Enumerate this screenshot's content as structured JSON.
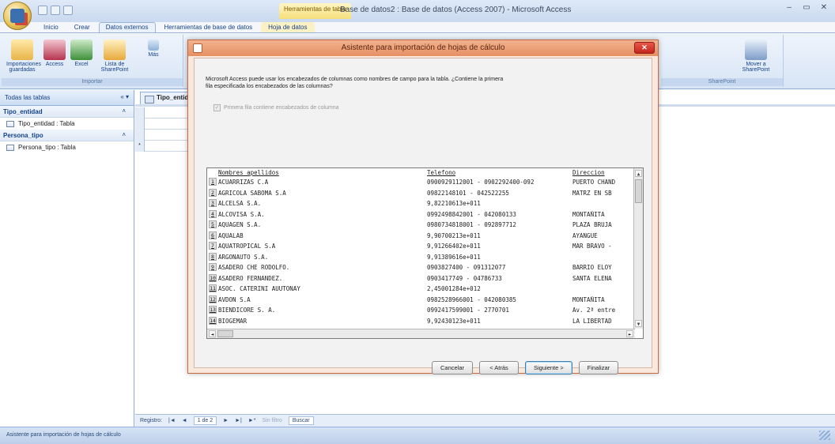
{
  "app": {
    "contextual_tab": "Herramientas de tabla",
    "window_title": "Base de datos2 : Base de datos (Access 2007) - Microsoft Access",
    "tabs": [
      "Inicio",
      "Crear",
      "Datos externos",
      "Herramientas de base de datos",
      "Hoja de datos"
    ],
    "window_buttons": [
      "–",
      "▭",
      "✕"
    ]
  },
  "ribbon": {
    "import_group_label": "Importar",
    "buttons": [
      "Importaciones guardadas",
      "Access",
      "Excel",
      "Lista de SharePoint",
      "Más"
    ],
    "right_button": "Mover a SharePoint",
    "right_group_label": "SharePoint"
  },
  "nav": {
    "header": "Todas las tablas",
    "header_ctrl": "« ▾",
    "groups": [
      {
        "name": "Tipo_entidad",
        "items": [
          "Tipo_entidad : Tabla"
        ]
      },
      {
        "name": "Persona_tipo",
        "items": [
          "Persona_tipo : Tabla"
        ]
      }
    ]
  },
  "doc": {
    "tab_label": "Tipo_entidad",
    "record_nav": {
      "label": "Registro:",
      "position": "1 de 2",
      "filter": "Sin filtro",
      "search": "Buscar"
    }
  },
  "dialog": {
    "title": "Asistente para importación de hojas de cálculo",
    "message": "Microsoft Access puede usar los encabezados de columnas como nombres de campo para la tabla. ¿Contiene la primera fila especificada los encabezados de las columnas?",
    "checkbox_label": "Primera fila contiene encabezados de columna",
    "columns": [
      "Nombres_apellidos",
      "Telefono",
      "Direccion"
    ],
    "rows": [
      [
        "ACUARRIZAS C.A",
        "0900929112001 - 0902292400-092",
        "PUERTO CHAND"
      ],
      [
        "AGRICOLA SABOMA S.A",
        "09822148101 - 042522255",
        "MATRZ EN SB"
      ],
      [
        "ALCELSA S.A.",
        "9,82210613e+011",
        ""
      ],
      [
        "ALCOVISA S.A.",
        "0992498842001 - 042080133",
        "MONTAÑITA"
      ],
      [
        "AQUAGEN S.A.",
        "0980734818001 - 092897712",
        "PLAZA BRUJA"
      ],
      [
        "AQUALAB",
        "9,90700213e+011",
        "AYANGUE"
      ],
      [
        "AQUATROPICAL S.A",
        "9,91266402e+011",
        "MAR BRAVO -"
      ],
      [
        "ARGONAUTO S.A.",
        "9,91389616e+011",
        ""
      ],
      [
        "ASADERO CHE RODOLFO.",
        "0903827400 - 091312077",
        "BARRIO ELOY"
      ],
      [
        "ASADERO FERNANDEZ.",
        "0903417749 - 04786733",
        "SANTA ELENA"
      ],
      [
        "ASOC. CATERINI AUUTONAY",
        "2,45001284e+012",
        ""
      ],
      [
        "AVDON S.A",
        "0982528966001 - 042080385",
        "MONTAÑITA"
      ],
      [
        "BIENDICORE S. A.",
        "0992417599001 - 2770701",
        "Av. 2ª entre"
      ],
      [
        "BIOGEMAR",
        "9,92430123e+011",
        "LA LIBERTAD"
      ]
    ],
    "buttons": {
      "cancel": "Cancelar",
      "back": "< Atrás",
      "next": "Siguiente >",
      "finish": "Finalizar"
    }
  },
  "status": {
    "text": "Asistente para importación de hojas de cálculo"
  }
}
